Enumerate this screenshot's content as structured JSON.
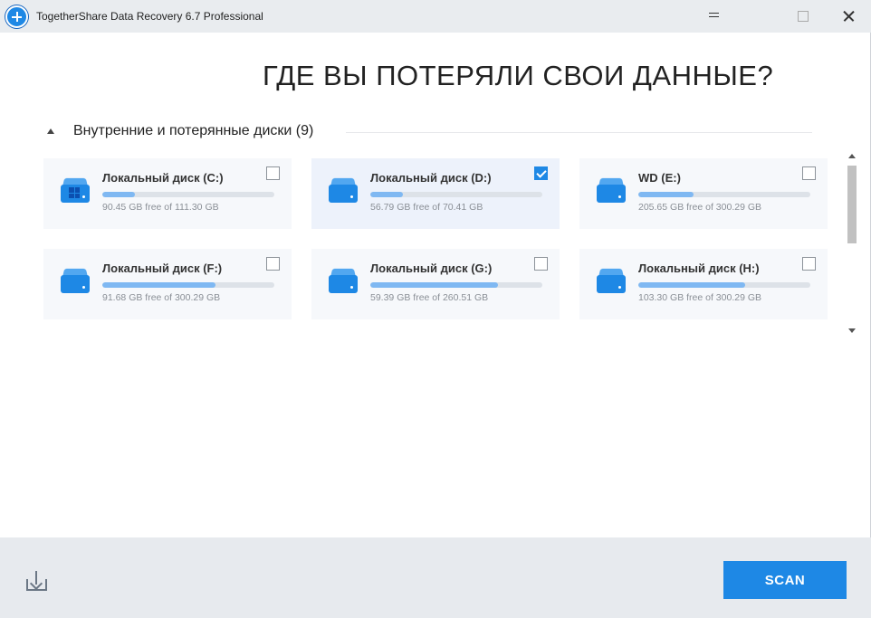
{
  "window": {
    "title": "TogetherShare Data Recovery 6.7 Professional",
    "icon": "plus-circle-icon"
  },
  "main": {
    "heading": "ГДЕ ВЫ ПОТЕРЯЛИ СВОИ ДАННЫЕ?",
    "section_title": "Внутренние и потерянные диски (9)"
  },
  "drives": [
    {
      "name": "Локальный диск (C:)",
      "free": "90.45 GB free of 111.30 GB",
      "used_fraction": 0.19,
      "checked": false,
      "system": true,
      "icon": "windows-drive-icon"
    },
    {
      "name": "Локальный диск (D:)",
      "free": "56.79 GB free of 70.41 GB",
      "used_fraction": 0.19,
      "checked": true,
      "system": false,
      "icon": "drive-icon"
    },
    {
      "name": "WD (E:)",
      "free": "205.65 GB free of 300.29 GB",
      "used_fraction": 0.32,
      "checked": false,
      "system": false,
      "icon": "drive-icon"
    },
    {
      "name": "Локальный диск (F:)",
      "free": "91.68 GB free of 300.29 GB",
      "used_fraction": 0.66,
      "checked": false,
      "system": false,
      "icon": "drive-icon"
    },
    {
      "name": "Локальный диск (G:)",
      "free": "59.39 GB free of 260.51 GB",
      "used_fraction": 0.74,
      "checked": false,
      "system": false,
      "icon": "drive-icon"
    },
    {
      "name": "Локальный диск (H:)",
      "free": "103.30 GB free of 300.29 GB",
      "used_fraction": 0.62,
      "checked": false,
      "system": false,
      "icon": "drive-icon"
    }
  ],
  "footer": {
    "scan_label": "SCAN",
    "export_icon": "download-tray-icon"
  },
  "colors": {
    "accent": "#1e88e5",
    "card_bg": "#f6f8fb",
    "footer_bg": "#e7eaee"
  }
}
